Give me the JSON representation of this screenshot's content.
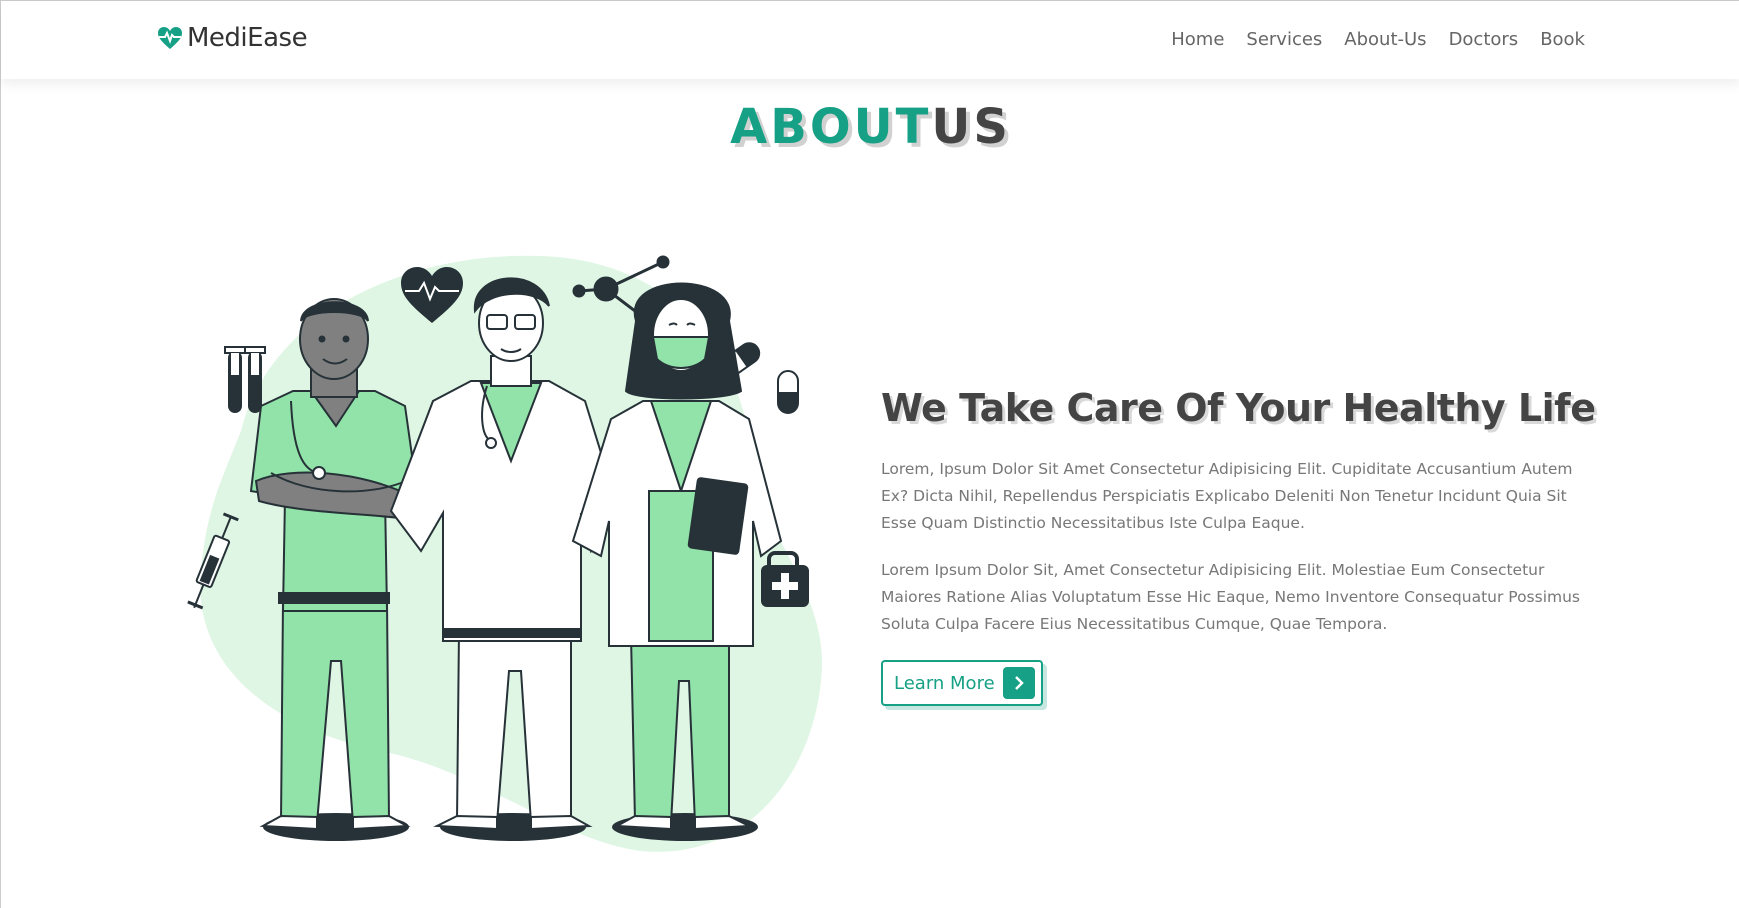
{
  "header": {
    "logo_text": "MediEase",
    "logo_icon": "heartbeat-icon",
    "nav": [
      {
        "label": "Home"
      },
      {
        "label": "Services"
      },
      {
        "label": "About-Us"
      },
      {
        "label": "Doctors"
      },
      {
        "label": "Book"
      }
    ]
  },
  "section": {
    "title_accent": "ABOUT",
    "title_rest": "US"
  },
  "about": {
    "heading": "We Take Care Of Your Healthy Life",
    "paragraph_1": "Lorem, Ipsum Dolor Sit Amet Consectetur Adipisicing Elit. Cupiditate Accusantium Autem Ex? Dicta Nihil, Repellendus Perspiciatis Explicabo Deleniti Non Tenetur Incidunt Quia Sit Esse Quam Distinctio Necessitatibus Iste Culpa Eaque.",
    "paragraph_2": "Lorem Ipsum Dolor Sit, Amet Consectetur Adipisicing Elit. Molestiae Eum Consectetur Maiores Ratione Alias Voluptatum Esse Hic Eaque, Nemo Inventore Consequatur Possimus Soluta Culpa Facere Eius Necessitatibus Cumque, Quae Tempora.",
    "button_label": "Learn More",
    "button_icon": "chevron-right-icon"
  },
  "colors": {
    "accent": "#16a085",
    "text_dark": "#444444",
    "text_muted": "#777777",
    "blob": "#dff6e4",
    "scrubs": "#92e3a9",
    "ink": "#263238"
  }
}
